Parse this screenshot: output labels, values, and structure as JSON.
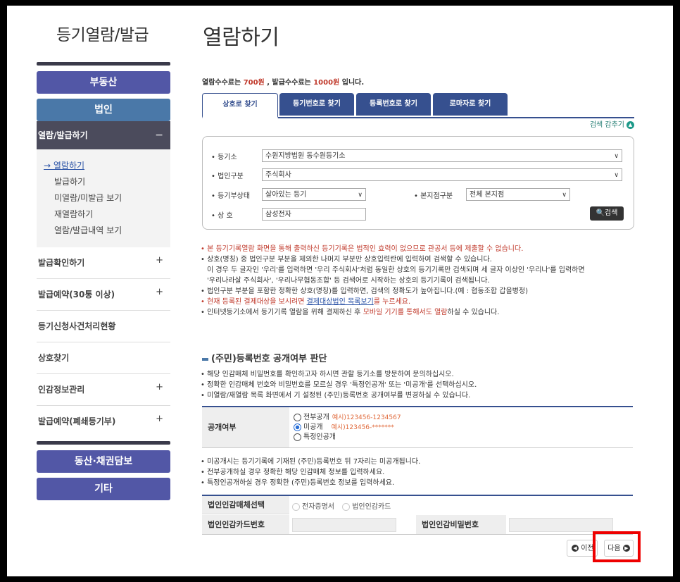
{
  "sidebar": {
    "title": "등기열람/발급",
    "cat_real_estate": "부동산",
    "cat_corporation": "법인",
    "active_menu": "열람/발급하기",
    "active_sign": "−",
    "submenu": [
      "→ 열람하기",
      "발급하기",
      "미열람/미발급 보기",
      "재열람하기",
      "열람/발급내역 보기"
    ],
    "menu_items": [
      {
        "label": "발급확인하기",
        "sign": "+"
      },
      {
        "label": "발급예약(30통 이상)",
        "sign": "+"
      },
      {
        "label": "등기신청사건처리현황",
        "sign": ""
      },
      {
        "label": "상호찾기",
        "sign": ""
      },
      {
        "label": "인감정보관리",
        "sign": "+"
      },
      {
        "label": "발급예약(폐쇄등기부)",
        "sign": "+"
      }
    ],
    "cat_movable": "동산·채권담보",
    "cat_other": "기타"
  },
  "main": {
    "title": "열람하기",
    "fee_prefix": "열람수수료는 ",
    "fee_view": "700원",
    "fee_mid": " , 발급수수료는 ",
    "fee_issue": "1000원",
    "fee_suffix": " 입니다.",
    "tabs": [
      "상호로 찾기",
      "등기번호로 찾기",
      "등록번호로 찾기",
      "로마자로 찾기"
    ],
    "toggle_label": "검색 감추기",
    "form": {
      "registry_label": "• 등기소",
      "registry_value": "수원지방법원 동수원등기소",
      "corp_type_label": "• 법인구분",
      "corp_type_value": "주식회사",
      "status_label": "• 등기부상태",
      "status_value": "살아있는 등기",
      "branch_label": "• 본지점구분",
      "branch_value": "전체 본지점",
      "name_label": "• 상 호",
      "name_value": "삼성전자",
      "search_button": "검색"
    },
    "notes": [
      {
        "text": "• 본 등기기록열람 화면을 통해 출력하신 등기기록은 법적인 효력이 없으므로 관공서 등에 제출할 수 없습니다.",
        "red": true
      },
      {
        "text": "• 상호(명칭) 중 법인구분 부분을 제외한 나머지 부분만 상호입력란에 입력하여 검색할 수 있습니다.",
        "red": false
      },
      {
        "text": "   이 경우 두 글자인 '우리'를 입력하면 '우리 주식회사'처럼 동일한 상호의 등기기록만 검색되며 세 글자 이상인 '우리나'를 입력하면",
        "red": false
      },
      {
        "text": "   '우리나라살 주식회사', '우리나무협동조합' 등 검색어로 시작하는 상호의 등기기록이 검색됩니다.",
        "red": false
      },
      {
        "text": "• 법인구분 부분을 포함한 정확한 상호(명칭)를 입력하면, 검색의 정확도가 높아집니다.(예 : 협동조합 갑을병정)",
        "red": false
      }
    ],
    "note_payment_a": "• 현재 등록된 결제대상을 보시려면 ",
    "note_payment_link": "결제대상법인 목록보기",
    "note_payment_b": "를 누르세요.",
    "note_mobile_a": "• 인터넷등기소에서 등기기록 열람을 위해 결제하신 후 ",
    "note_mobile_red": "모바일 기기를 통해서도 열람",
    "note_mobile_b": "하실 수 있습니다.",
    "section_title": "(주민)등록번호 공개여부 판단",
    "notes2": [
      "• 해당 인감매체 비밀번호를 확인하고자 하시면 관할 등기소를 방문하여 문의하십시오.",
      "• 정확한 인감매체 번호와 비밀번호를 모르실 경우 '특정인공개' 또는 '미공개'를 선택하십시오.",
      "• 미열람/재열람 목록 화면에서 기 설정된 (주민)등록번호 공개여부를 변경하실 수 있습니다."
    ],
    "disclosure": {
      "label": "공개여부",
      "opt_full": "전부공개",
      "opt_full_example": "예시)123456-1234567",
      "opt_private": "미공개",
      "opt_private_example": "예시)123456-*******",
      "opt_specific": "특정인공개"
    },
    "notes3": [
      "• 미공개시는 등기기록에 기재된 (주민)등록번호 뒤 7자리는 미공개됩니다.",
      "• 전부공개하실 경우 정확한 해당 인감매체 정보를 입력하세요.",
      "• 특정인공개하실 경우 정확한 (주민)등록번호 정보를 입력하세요."
    ],
    "seal": {
      "media_label": "법인인감매체선택",
      "opt_cert": "전자증명서",
      "opt_card": "법인인감카드",
      "card_no_label": "법인인감카드번호",
      "password_label": "법인인감비밀번호"
    },
    "prev_button": "이전",
    "next_button": "다음"
  }
}
